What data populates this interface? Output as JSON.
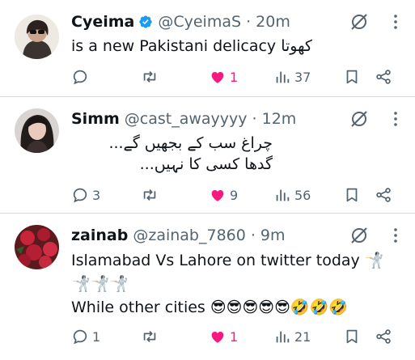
{
  "tweets": [
    {
      "name": "Cyeima",
      "verified": true,
      "handle": "@CyeimaS",
      "time": "· 20m",
      "text_rtl": "کھوتا",
      "text": "is a new Pakistani delicacy",
      "replies": "",
      "retweets": "",
      "likes": "1",
      "views": "37"
    },
    {
      "name": "Simm",
      "handle": "@cast_awayyyy",
      "time": "· 12m",
      "line1": "چراغ سب کے بجھیں گے...",
      "line2": "گدھا کسی کا نہیں...",
      "replies": "3",
      "retweets": "",
      "likes": "9",
      "views": "56"
    },
    {
      "name": "zainab",
      "handle": "@zainab_7860",
      "time": "· 9m",
      "line1": "Islamabad Vs Lahore on twitter today 🤺",
      "line2": "🤺🤺🤺",
      "line3": "While other cities 😎😎😎😎😎🤣🤣🤣",
      "replies": "1",
      "retweets": "",
      "likes": "1",
      "views": "21"
    }
  ],
  "colors": {
    "accent": "#1d9bf0",
    "like": "#f91880",
    "muted": "#536471",
    "divider": "#cfd9de"
  },
  "icons": [
    "verified-badge-icon",
    "mute-icon",
    "more-icon",
    "reply-icon",
    "retweet-icon",
    "like-icon",
    "views-icon",
    "bookmark-icon",
    "share-icon"
  ]
}
